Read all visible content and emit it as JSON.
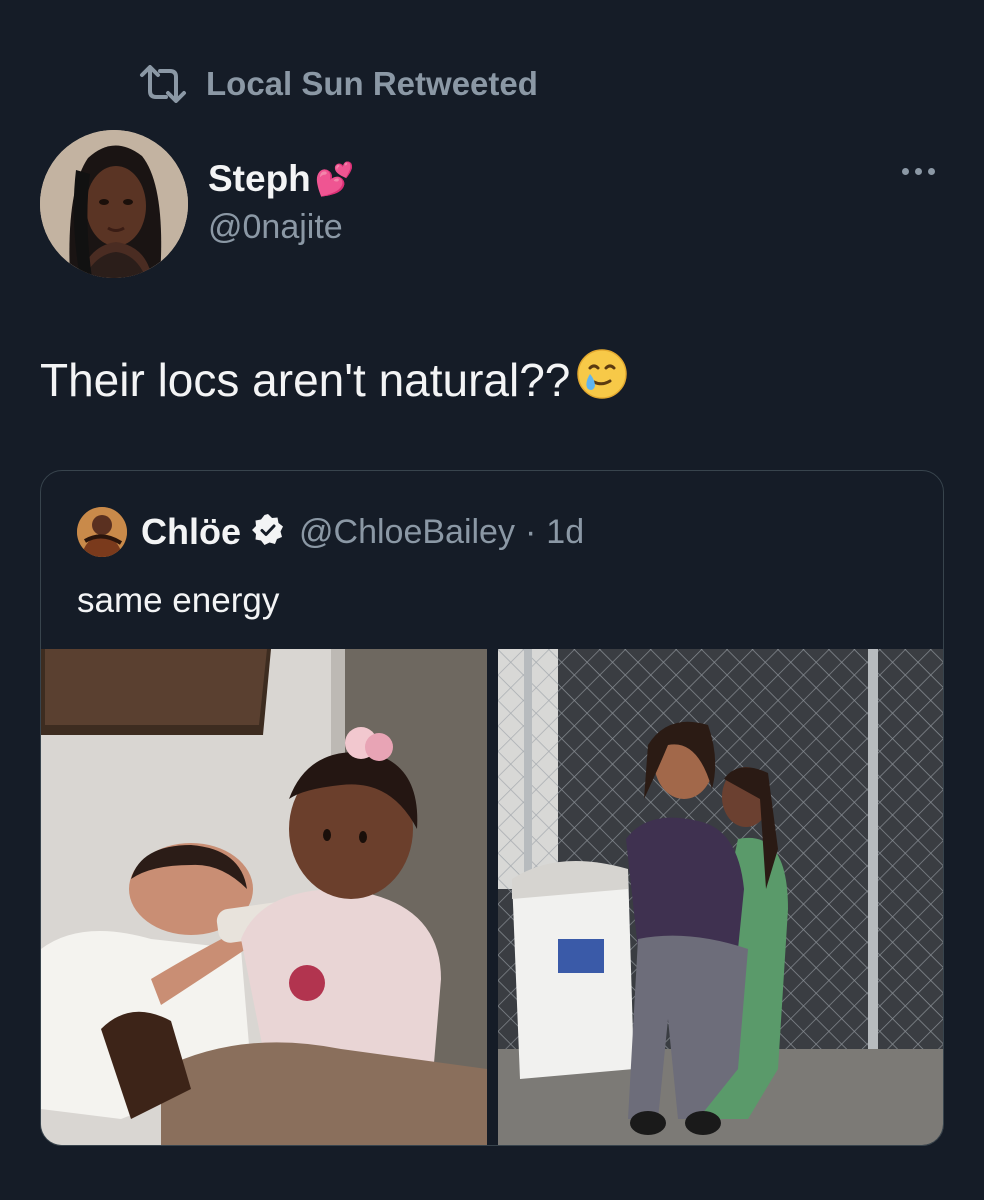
{
  "retweet": {
    "label": "Local Sun Retweeted",
    "icon": "retweet-icon"
  },
  "author": {
    "name": "Steph",
    "name_emoji": "💕",
    "handle": "@0najite",
    "avatar_icon": "profile-photo"
  },
  "tweet": {
    "text": "Their locs aren't natural??",
    "emoji": "🥲"
  },
  "quoted": {
    "name": "Chlöe",
    "verified_icon": "verified-badge-icon",
    "handle": "@ChloeBailey",
    "separator": "·",
    "time": "1d",
    "text": "same energy",
    "media": [
      {
        "icon": "photo-toddler-feeding-baby"
      },
      {
        "icon": "photo-sisters-sitting-by-fence"
      }
    ]
  },
  "colors": {
    "background": "#151c27",
    "text": "#e7e9ea",
    "secondary": "#8b98a5",
    "border": "#38444d"
  }
}
